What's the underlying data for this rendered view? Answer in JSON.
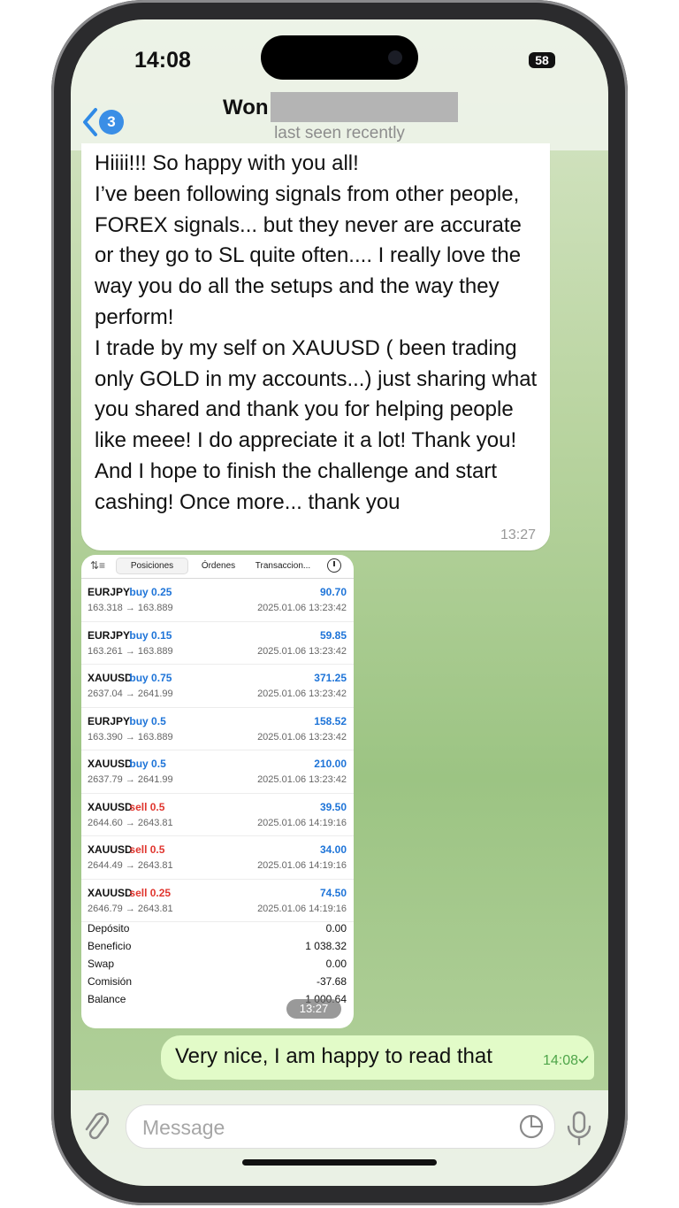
{
  "status": {
    "time": "14:08",
    "battery": "58"
  },
  "header": {
    "back_badge": "3",
    "chat_name": "Won",
    "last_seen": "last seen recently"
  },
  "incoming_message": {
    "text": "Hiiii!!! So happy with you all!\nI’ve been following signals from other people, FOREX signals... but they never are accurate or they go to SL quite often.... I really love the way you do all the setups and the way they perform!\nI trade by my self on XAUUSD ( been trading only GOLD in my accounts...) just sharing what you shared and thank you for helping people like meee! I do appreciate it a lot! Thank you! And I hope to finish the challenge and start cashing! Once more... thank you",
    "time": "13:27"
  },
  "screenshot": {
    "tabs": [
      "Posiciones",
      "Órdenes",
      "Transaccion..."
    ],
    "trades": [
      {
        "symbol": "EURJPY",
        "side": "buy 0.25",
        "type": "buy",
        "profit": "90.70",
        "prices": "163.318 → 163.889",
        "date": "2025.01.06 13:23:42"
      },
      {
        "symbol": "EURJPY",
        "side": "buy 0.15",
        "type": "buy",
        "profit": "59.85",
        "prices": "163.261 → 163.889",
        "date": "2025.01.06 13:23:42"
      },
      {
        "symbol": "XAUUSD",
        "side": "buy 0.75",
        "type": "buy",
        "profit": "371.25",
        "prices": "2637.04 → 2641.99",
        "date": "2025.01.06 13:23:42"
      },
      {
        "symbol": "EURJPY",
        "side": "buy 0.5",
        "type": "buy",
        "profit": "158.52",
        "prices": "163.390 → 163.889",
        "date": "2025.01.06 13:23:42"
      },
      {
        "symbol": "XAUUSD",
        "side": "buy 0.5",
        "type": "buy",
        "profit": "210.00",
        "prices": "2637.79 → 2641.99",
        "date": "2025.01.06 13:23:42"
      },
      {
        "symbol": "XAUUSD",
        "side": "sell 0.5",
        "type": "sell",
        "profit": "39.50",
        "prices": "2644.60 → 2643.81",
        "date": "2025.01.06 14:19:16"
      },
      {
        "symbol": "XAUUSD",
        "side": "sell 0.5",
        "type": "sell",
        "profit": "34.00",
        "prices": "2644.49 → 2643.81",
        "date": "2025.01.06 14:19:16"
      },
      {
        "symbol": "XAUUSD",
        "side": "sell 0.25",
        "type": "sell",
        "profit": "74.50",
        "prices": "2646.79 → 2643.81",
        "date": "2025.01.06 14:19:16"
      }
    ],
    "summary": [
      {
        "label": "Depósito",
        "value": "0.00"
      },
      {
        "label": "Beneficio",
        "value": "1 038.32"
      },
      {
        "label": "Swap",
        "value": "0.00"
      },
      {
        "label": "Comisión",
        "value": "-37.68"
      },
      {
        "label": "Balance",
        "value": "1 000.64"
      }
    ],
    "time": "13:27"
  },
  "outgoing_message": {
    "text": "Very nice, I am happy to read that",
    "time": "14:08"
  },
  "composer": {
    "placeholder": "Message"
  },
  "colors": {
    "accent": "#3a8ee6",
    "buy": "#1e74d8",
    "sell": "#e0362f",
    "outgoing_bubble": "#e2fbc8"
  }
}
